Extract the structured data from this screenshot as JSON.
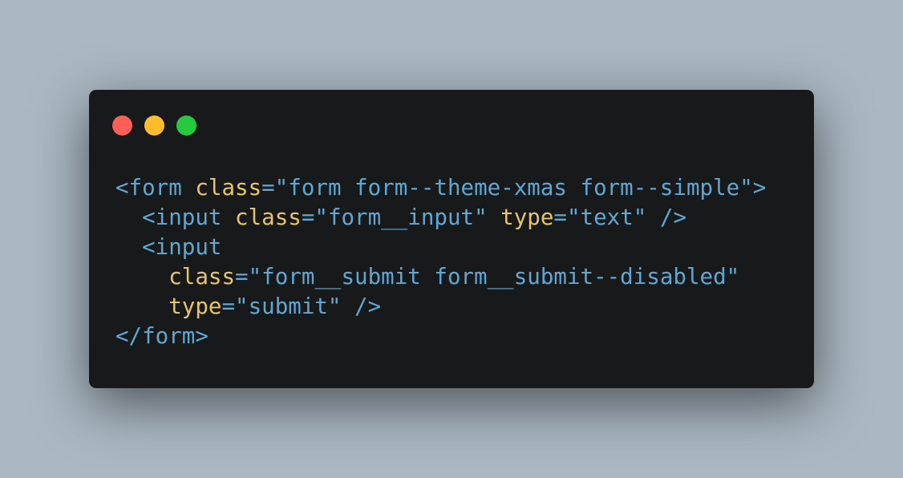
{
  "window_controls": [
    {
      "name": "close",
      "color": "#ff5f56"
    },
    {
      "name": "minimize",
      "color": "#ffbd2e"
    },
    {
      "name": "maximize",
      "color": "#27c93f"
    }
  ],
  "colors": {
    "background": "#abb8c3",
    "window": "#18191b",
    "tag": "#5fa8d3",
    "attribute": "#e6c66b",
    "string": "#5fa8d3"
  },
  "code_lines": [
    [
      {
        "t": "tag",
        "v": "<form"
      },
      {
        "t": "punct",
        "v": " "
      },
      {
        "t": "attr",
        "v": "class"
      },
      {
        "t": "punct",
        "v": "="
      },
      {
        "t": "str",
        "v": "\"form form--theme-xmas form--simple\""
      },
      {
        "t": "tag",
        "v": ">"
      }
    ],
    [
      {
        "t": "punct",
        "v": "  "
      },
      {
        "t": "tag",
        "v": "<input"
      },
      {
        "t": "punct",
        "v": " "
      },
      {
        "t": "attr",
        "v": "class"
      },
      {
        "t": "punct",
        "v": "="
      },
      {
        "t": "str",
        "v": "\"form__input\""
      },
      {
        "t": "punct",
        "v": " "
      },
      {
        "t": "attr",
        "v": "type"
      },
      {
        "t": "punct",
        "v": "="
      },
      {
        "t": "str",
        "v": "\"text\""
      },
      {
        "t": "punct",
        "v": " "
      },
      {
        "t": "tag",
        "v": "/>"
      }
    ],
    [
      {
        "t": "punct",
        "v": "  "
      },
      {
        "t": "tag",
        "v": "<input"
      }
    ],
    [
      {
        "t": "punct",
        "v": "    "
      },
      {
        "t": "attr",
        "v": "class"
      },
      {
        "t": "punct",
        "v": "="
      },
      {
        "t": "str",
        "v": "\"form__submit form__submit--disabled\""
      }
    ],
    [
      {
        "t": "punct",
        "v": "    "
      },
      {
        "t": "attr",
        "v": "type"
      },
      {
        "t": "punct",
        "v": "="
      },
      {
        "t": "str",
        "v": "\"submit\""
      },
      {
        "t": "punct",
        "v": " "
      },
      {
        "t": "tag",
        "v": "/>"
      }
    ],
    [
      {
        "t": "tag",
        "v": "</form>"
      }
    ]
  ]
}
